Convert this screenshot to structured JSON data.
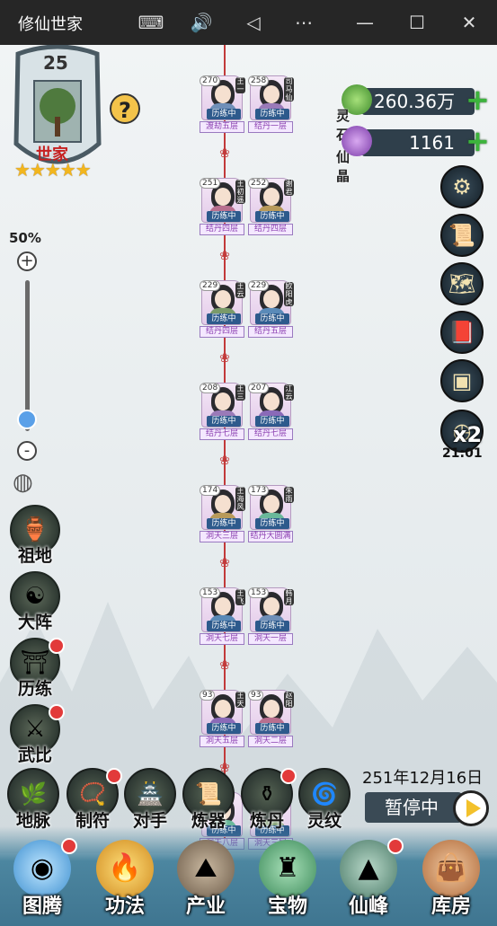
{
  "window": {
    "title": "修仙世家",
    "icons": [
      "keyboard-icon",
      "volume-icon",
      "back-icon",
      "more-icon",
      "minimize-icon",
      "maximize-icon",
      "close-icon"
    ]
  },
  "family": {
    "level": "25",
    "name": "世家",
    "stars": "★★★★★",
    "stars_count": 5,
    "help_glyph": "?"
  },
  "zoom": {
    "percent": "50%",
    "plus": "+",
    "minus": "-",
    "level_fraction": 0.08
  },
  "currency": [
    {
      "label": "灵石",
      "value": "260.36万",
      "plus": "+"
    },
    {
      "label": "仙晶",
      "value": "1161",
      "plus": "+"
    }
  ],
  "right_menu": {
    "speed": "x2",
    "timer": "21:01",
    "icons": [
      "settings-icon",
      "scroll-icon",
      "map-icon",
      "red-book-icon",
      "treasure-map-icon",
      "speed-clock-icon"
    ]
  },
  "left_menu": [
    {
      "label": "祖地",
      "icon": "ancestor-icon",
      "dot": false
    },
    {
      "label": "大阵",
      "icon": "array-icon",
      "dot": false
    },
    {
      "label": "历练",
      "icon": "training-icon",
      "dot": true
    },
    {
      "label": "武比",
      "icon": "duel-icon",
      "dot": true
    }
  ],
  "tree": {
    "knot_glyph": "❀",
    "pairs": [
      {
        "left": {
          "age": "270",
          "name": "王一",
          "status": "历练中",
          "realm": "渡劫五层"
        },
        "right": {
          "age": "258",
          "name": "司马仙",
          "status": "历练中",
          "realm": "结丹一层"
        }
      },
      {
        "left": {
          "age": "251",
          "name": "王初遥",
          "status": "历练中",
          "realm": "结丹四层"
        },
        "right": {
          "age": "252",
          "name": "谢君",
          "status": "历练中",
          "realm": "结丹四层"
        }
      },
      {
        "left": {
          "age": "229",
          "name": "王云",
          "status": "历练中",
          "realm": "结丹四层"
        },
        "right": {
          "age": "229",
          "name": "欧阳虎",
          "status": "历练中",
          "realm": "结丹五层"
        }
      },
      {
        "left": {
          "age": "208",
          "name": "王三",
          "status": "历练中",
          "realm": "结丹七层"
        },
        "right": {
          "age": "207",
          "name": "江云",
          "status": "历练中",
          "realm": "结丹七层"
        }
      },
      {
        "left": {
          "age": "174",
          "name": "王海风",
          "status": "历练中",
          "realm": "洞天三层"
        },
        "right": {
          "age": "173",
          "name": "朱雨",
          "status": "历练中",
          "realm": "结丹大圆满"
        }
      },
      {
        "left": {
          "age": "153",
          "name": "王飞",
          "status": "历练中",
          "realm": "洞天七层"
        },
        "right": {
          "age": "153",
          "name": "韩月",
          "status": "历练中",
          "realm": "洞天一层"
        }
      },
      {
        "left": {
          "age": "93",
          "name": "王天",
          "status": "历练中",
          "realm": "洞天五层"
        },
        "right": {
          "age": "93",
          "name": "赵阳",
          "status": "历练中",
          "realm": "洞天二层"
        }
      },
      {
        "left": {
          "age": "",
          "name": "",
          "status": "历练中",
          "realm": "洞天八层"
        },
        "right": {
          "age": "",
          "name": "",
          "status": "历练中",
          "realm": "洞天三层"
        }
      }
    ]
  },
  "date": "251年12月16日",
  "pause_label": "暂停中",
  "tools": [
    {
      "label": "地脉",
      "icon": "earth-vein-icon",
      "dot": false
    },
    {
      "label": "制符",
      "icon": "talisman-icon",
      "dot": true
    },
    {
      "label": "对手",
      "icon": "rival-icon",
      "dot": false
    },
    {
      "label": "炼器",
      "icon": "forge-icon",
      "dot": false
    },
    {
      "label": "炼丹",
      "icon": "alchemy-icon",
      "dot": true
    },
    {
      "label": "灵纹",
      "icon": "rune-icon",
      "dot": false
    }
  ],
  "nav": [
    {
      "label": "图腾",
      "icon": "totem-icon",
      "dot": true
    },
    {
      "label": "功法",
      "icon": "technique-icon",
      "dot": false
    },
    {
      "label": "产业",
      "icon": "industry-icon",
      "dot": false
    },
    {
      "label": "宝物",
      "icon": "treasure-icon",
      "dot": false
    },
    {
      "label": "仙峰",
      "icon": "immortal-peak-icon",
      "dot": true
    },
    {
      "label": "库房",
      "icon": "warehouse-icon",
      "dot": false
    }
  ]
}
